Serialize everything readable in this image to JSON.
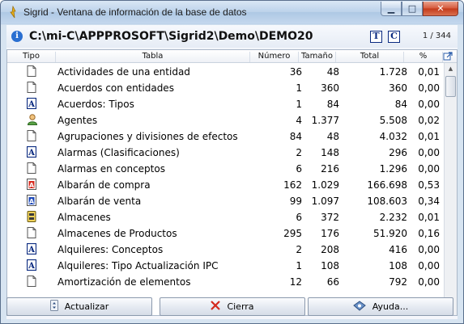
{
  "window": {
    "title": "Sigrid - Ventana de información de la base de datos",
    "controls": {
      "minimize": "▁",
      "maximize": "□",
      "close": "✕"
    }
  },
  "pathbar": {
    "path": "C:\\mi-C\\APPPROSOFT\\Sigrid2\\Demo\\DEMO20",
    "t_button": "T",
    "c_button": "C",
    "counter": "1 / 344"
  },
  "grid": {
    "columns": [
      "Tipo",
      "Tabla",
      "Número",
      "Tamaño",
      "Total",
      "%"
    ],
    "rows": [
      {
        "icon": "doc",
        "tabla": "Actividades de una entidad",
        "numero": "36",
        "tamano": "48",
        "total": "1.728",
        "pct": "0,01"
      },
      {
        "icon": "doc",
        "tabla": "Acuerdos con entidades",
        "numero": "1",
        "tamano": "360",
        "total": "360",
        "pct": "0,00"
      },
      {
        "icon": "a-box",
        "tabla": "Acuerdos: Tipos",
        "numero": "1",
        "tamano": "84",
        "total": "84",
        "pct": "0,00"
      },
      {
        "icon": "person",
        "tabla": "Agentes",
        "numero": "4",
        "tamano": "1.377",
        "total": "5.508",
        "pct": "0,02"
      },
      {
        "icon": "doc",
        "tabla": "Agrupaciones y divisiones de efectos",
        "numero": "84",
        "tamano": "48",
        "total": "4.032",
        "pct": "0,01"
      },
      {
        "icon": "a-box",
        "tabla": "Alarmas (Clasificaciones)",
        "numero": "2",
        "tamano": "148",
        "total": "296",
        "pct": "0,00"
      },
      {
        "icon": "doc",
        "tabla": "Alarmas en conceptos",
        "numero": "6",
        "tamano": "216",
        "total": "1.296",
        "pct": "0,00"
      },
      {
        "icon": "a-red",
        "tabla": "Albarán de compra",
        "numero": "162",
        "tamano": "1.029",
        "total": "166.698",
        "pct": "0,53"
      },
      {
        "icon": "a-blue",
        "tabla": "Albarán de venta",
        "numero": "99",
        "tamano": "1.097",
        "total": "108.603",
        "pct": "0,34"
      },
      {
        "icon": "warehouse",
        "tabla": "Almacenes",
        "numero": "6",
        "tamano": "372",
        "total": "2.232",
        "pct": "0,01"
      },
      {
        "icon": "doc",
        "tabla": "Almacenes de Productos",
        "numero": "295",
        "tamano": "176",
        "total": "51.920",
        "pct": "0,16"
      },
      {
        "icon": "a-box",
        "tabla": "Alquileres: Conceptos",
        "numero": "2",
        "tamano": "208",
        "total": "416",
        "pct": "0,00"
      },
      {
        "icon": "a-box",
        "tabla": "Alquileres: Tipo Actualización IPC",
        "numero": "1",
        "tamano": "108",
        "total": "108",
        "pct": "0,00"
      },
      {
        "icon": "doc",
        "tabla": "Amortización de elementos",
        "numero": "12",
        "tamano": "66",
        "total": "792",
        "pct": "0,00"
      }
    ]
  },
  "buttons": {
    "actualizar": "Actualizar",
    "cierra": "Cierra",
    "ayuda": "Ayuda..."
  },
  "colors": {
    "accent": "#0a2a80",
    "close_icon": "#d42a1e"
  }
}
